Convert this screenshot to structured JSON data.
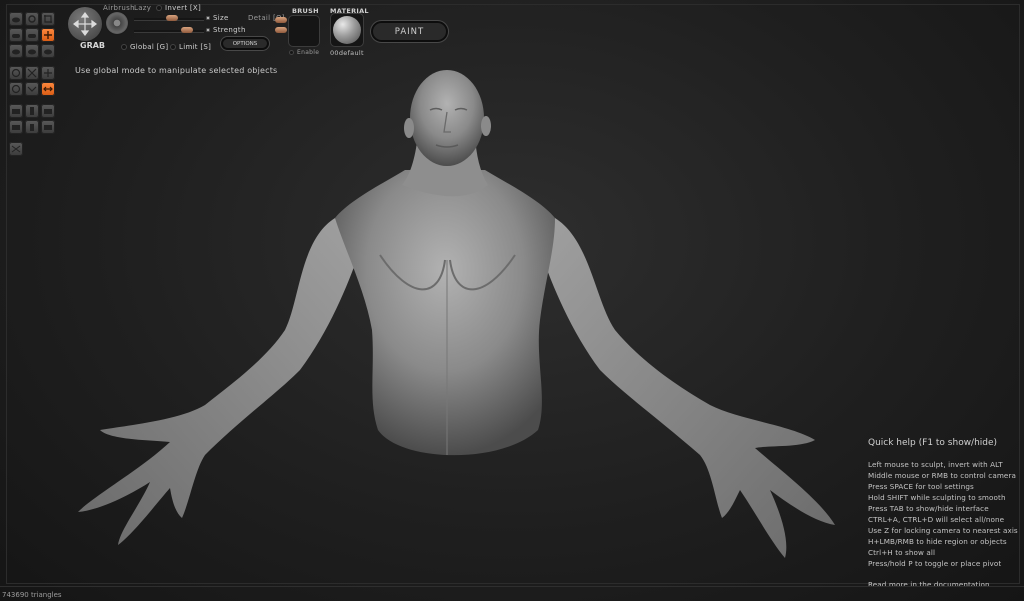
{
  "tool": {
    "name": "GRAB"
  },
  "top_options": {
    "airbrush": "Airbrush",
    "lazy": "Lazy",
    "invert": "Invert [X]",
    "size": "Size",
    "strength": "Strength",
    "detail": "Detail [Q]",
    "global": "Global [G]",
    "limit": "Limit [S]",
    "options_button": "OPTIONS"
  },
  "brush": {
    "header": "BRUSH",
    "enable": "Enable"
  },
  "material": {
    "header": "MATERIAL",
    "name": "00default"
  },
  "paint_button": "PAINT",
  "status_message": "Use global mode to manipulate selected objects",
  "quick_help": {
    "title": "Quick help (F1 to show/hide)",
    "lines": [
      "Left mouse to sculpt, invert with ALT",
      "Middle mouse or RMB to control camera",
      "Press SPACE for tool settings",
      "Hold SHIFT while sculpting to smooth",
      "Press TAB to show/hide interface",
      "CTRL+A, CTRL+D will select all/none",
      "Use Z for locking camera to nearest axis",
      "H+LMB/RMB to hide region or objects",
      "Ctrl+H to show all",
      "Press/hold P to toggle or place pivot"
    ],
    "footer_link": "Read more in the documentation"
  },
  "triangle_count": "743690 triangles",
  "colors": {
    "accent": "#e8692a",
    "background": "#1e1e1e",
    "model": "#8f8f8f"
  }
}
